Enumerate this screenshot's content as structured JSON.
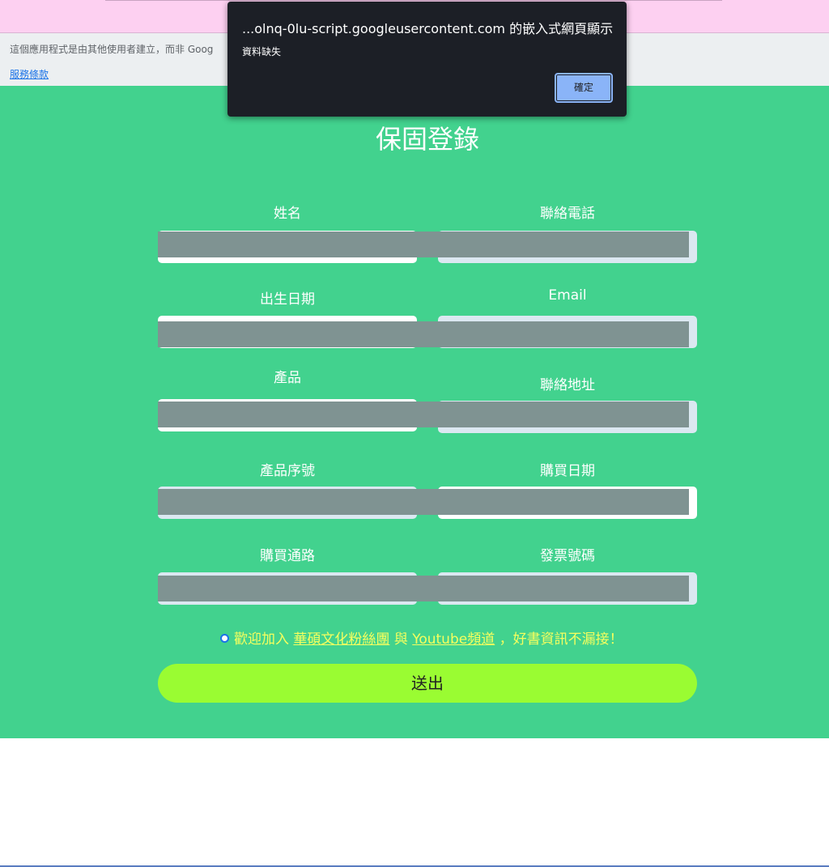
{
  "banner": {
    "notice_text": "這個應用程式是由其他使用者建立，而非 Goog",
    "terms_link": "服務條款"
  },
  "form": {
    "title": "保固登錄",
    "fields": [
      {
        "label": "姓名"
      },
      {
        "label": "聯絡電話"
      },
      {
        "label": "出生日期"
      },
      {
        "label": "Email"
      },
      {
        "label": "產品"
      },
      {
        "label": "聯絡地址"
      },
      {
        "label": "產品序號"
      },
      {
        "label": "購買日期"
      },
      {
        "label": "購買通路"
      },
      {
        "label": "發票號碼"
      }
    ],
    "optin": {
      "prefix": "歡迎加入",
      "link1": "華碩文化粉絲團",
      "middle": "與",
      "link2": "Youtube頻道",
      "suffix": "，好書資訊不漏接！"
    },
    "submit_label": "送出"
  },
  "dialog": {
    "title": "...olnq-0lu-script.googleusercontent.com 的嵌入式網頁顯示",
    "message": "資料缺失",
    "ok_label": "確定"
  },
  "colors": {
    "page_bg": "#42d28e",
    "banner_bg": "#fdd0f1",
    "submit_bg": "#9afc32",
    "optin_text": "#f5ff5e",
    "dialog_bg": "#1c1f26"
  }
}
